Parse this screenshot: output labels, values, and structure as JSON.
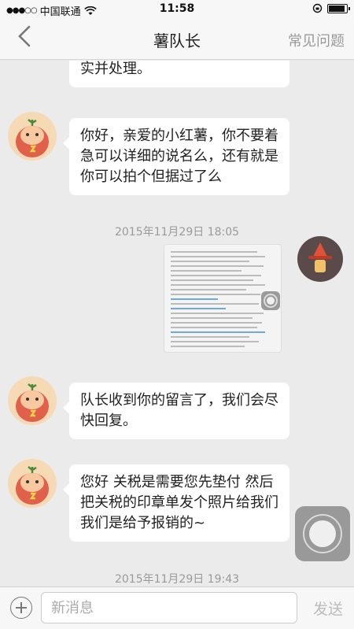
{
  "status_bar": {
    "carrier": "中国联通",
    "time": "11:58",
    "signal_icon": "signal-dots-icon",
    "wifi_icon": "wifi-icon",
    "battery_icon": "battery-icon"
  },
  "nav": {
    "back_icon": "chevron-left-icon",
    "title": "薯队长",
    "right_label": "常见问题"
  },
  "messages": [
    {
      "side": "left",
      "text": "实并处理。"
    },
    {
      "side": "left",
      "text": "你好，亲爱的小红薯，你不要着急可以详细的说名么，还有就是你可以拍个但据过了么"
    },
    {
      "type": "timestamp",
      "text": "2015年11月29日 18:05"
    },
    {
      "side": "right",
      "type": "image"
    },
    {
      "side": "left",
      "text": "队长收到你的留言了，我们会尽快回复。"
    },
    {
      "side": "left",
      "text": "您好 关税是需要您先垫付 然后把关税的印章单发个照片给我们 我们是给予报销的~"
    },
    {
      "type": "timestamp",
      "text": "2015年11月29日 19:43"
    }
  ],
  "input": {
    "placeholder": "新消息",
    "send_label": "发送",
    "plus_icon": "plus-circle-icon"
  },
  "colors": {
    "bubble": "#ffffff",
    "background": "#ebebeb",
    "avatar_bg": "#f6d9b5"
  }
}
